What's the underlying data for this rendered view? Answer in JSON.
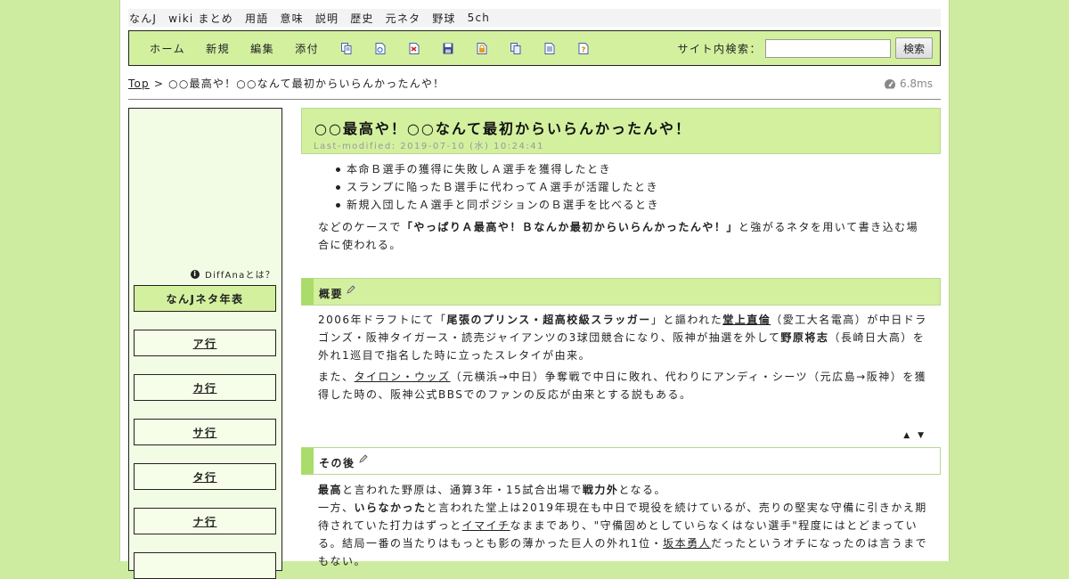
{
  "topnav": [
    "なんJ",
    "wiki まとめ",
    "用語",
    "意味",
    "説明",
    "歴史",
    "元ネタ",
    "野球",
    "5ch"
  ],
  "toolbar": {
    "links": [
      "ホーム",
      "新規",
      "編集",
      "添付"
    ],
    "icons": [
      "copy-page-icon",
      "rename-page-icon",
      "diff-icon",
      "backup-icon",
      "lock-icon",
      "page-list-icon",
      "recent-changes-icon",
      "help-icon"
    ],
    "search_label": "サイト内検索：",
    "search_value": "",
    "search_button": "検索"
  },
  "breadcrumb": {
    "top": "Top",
    "separator": ">",
    "current": "○○最高や！○○なんて最初からいらんかったんや！"
  },
  "perf": "6.8ms",
  "sidebar": {
    "diffana": "DiffAnaとは？",
    "title": "なんJネタ年表",
    "items": [
      "ア行",
      "カ行",
      "サ行",
      "タ行",
      "ナ行",
      ""
    ]
  },
  "article": {
    "title": "○○最高や！○○なんて最初からいらんかったんや！",
    "modified": "Last-modified: 2019-07-10 (水) 10:24:41",
    "list": [
      "本命Ｂ選手の獲得に失敗しＡ選手を獲得したとき",
      "スランプに陥ったＢ選手に代わってＡ選手が活躍したとき",
      "新規入団したＡ選手と同ポジションのＢ選手を比べるとき"
    ],
    "intro_pre": "などのケースで",
    "intro_bold": "「やっぱりＡ最高や！Ｂなんか最初からいらんかったんや！」",
    "intro_post": "と強がるネタを用いて書き込む場合に使われる。",
    "section1": "概要",
    "s1p1": {
      "a": "2006年ドラフトにて「",
      "b": "尾張のプリンス・超高校級スラッガー",
      "c": "」と謳われた",
      "d": "堂上直倫",
      "e": "（愛工大名電高）が中日ドラゴンズ・阪神タイガース・読売ジャイアンツの3球団競合になり、阪神が抽選を外して",
      "f": "野原将志",
      "g": "（長崎日大高）を外れ1巡目で指名した時に立ったスレタイが由来。"
    },
    "s1p2": {
      "a": "また、",
      "b": "タイロン・ウッズ",
      "c": "（元横浜→中日）争奪戦で中日に敗れ、代わりにアンディ・シーツ（元広島→阪神）を獲得した時の、阪神公式BBSでのファンの反応が由来とする説もある。"
    },
    "updown": "▲ ▼",
    "section2": "その後",
    "s2p1": {
      "a": "最高",
      "b": "と言われた野原は、通算3年・15試合出場で",
      "c": "戦力外",
      "d": "となる。"
    },
    "s2p2": {
      "a": "一方、",
      "b": "いらなかった",
      "c": "と言われた堂上は2019年現在も中日で現役を続けているが、売りの堅実な守備に引きかえ期待されていた打力はずっと",
      "d": "イマイチ",
      "e": "なままであり、\"守備固めとしていらなくはない選手\"程度にはとどまっている。結局一番の当たりはもっとも影の薄かった巨人の外れ1位・",
      "f": "坂本勇人",
      "g": "だったというオチになったのは言うまでもない。"
    }
  },
  "colors": {
    "background": "#cdeca0",
    "accent": "#d3f09f",
    "heading_bar": "#a9dc6a"
  }
}
